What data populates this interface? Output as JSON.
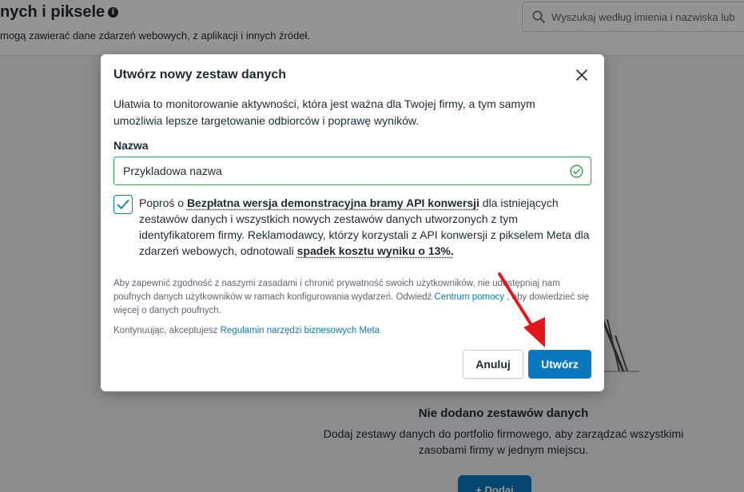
{
  "background": {
    "title": "nych i piksele",
    "subtitle": "mogą zawierać dane zdarzeń webowych, z aplikacji i innych źródeł.",
    "search_placeholder": "Wyszukaj według imienia i nazwiska lub",
    "empty_state": {
      "title": "Nie dodano zestawów danych",
      "description": "Dodaj zestawy danych do portfolio firmowego, aby zarządzać wszystkimi zasobami firmy w jednym miejscu.",
      "add_label": "+ Dodaj"
    }
  },
  "modal": {
    "title": "Utwórz nowy zestaw danych",
    "description": "Ułatwia to monitorowanie aktywności, która jest ważna dla Twojej firmy, a tym samym umożliwia lepsze targetowanie odbiorców i poprawę wyników.",
    "name_label": "Nazwa",
    "name_value": "Przykladowa nazwa",
    "consent": {
      "checked": true,
      "prefix": "Poproś o ",
      "link1": "Bezpłatna wersja demonstracyjna bramy API konwersji",
      "middle": " dla istniejących zestawów danych i wszystkich nowych zestawów danych utworzonych z tym identyfikatorem firmy. Reklamodawcy, którzy korzystali z API konwersji z pikselem Meta dla zdarzeń webowych, odnotowali ",
      "link2": "spadek kosztu wyniku o 13%."
    },
    "privacy": {
      "text": "Aby zapewnić zgodność z naszymi zasadami i chronić prywatność swoich użytkowników, nie udostępniaj nam poufnych danych użytkowników w ramach konfigurowania wydarzeń. Odwiedź ",
      "link": "Centrum pomocy",
      "suffix": " , aby dowiedzieć się więcej o danych poufnych."
    },
    "terms": {
      "text": "Kontynuując, akceptujesz ",
      "link": "Regulamin narzędzi biznesowych Meta"
    },
    "cancel_label": "Anuluj",
    "create_label": "Utwórz"
  },
  "colors": {
    "primary": "#0a78be",
    "success": "#31a24c",
    "arrow": "#e3161b"
  }
}
